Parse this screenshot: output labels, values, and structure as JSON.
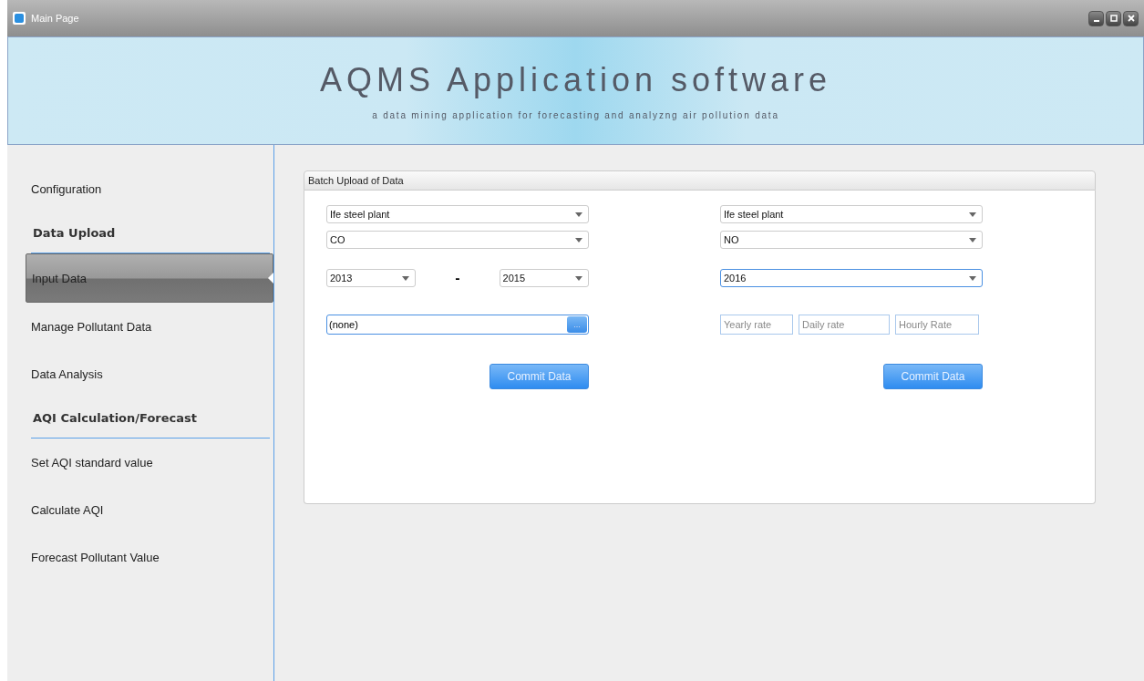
{
  "window": {
    "title": "Main Page"
  },
  "header": {
    "title": "AQMS Application software",
    "subtitle": "a data mining application for forecasting and analyzng air pollution data"
  },
  "sidebar": {
    "items": [
      {
        "kind": "item",
        "label": "Configuration",
        "selected": false
      },
      {
        "kind": "heading",
        "label": "Data Upload"
      },
      {
        "kind": "item",
        "label": "Input Data",
        "selected": true
      },
      {
        "kind": "item",
        "label": "Manage Pollutant Data",
        "selected": false
      },
      {
        "kind": "item",
        "label": "Data Analysis",
        "selected": false
      },
      {
        "kind": "heading",
        "label": "AQI Calculation/Forecast"
      },
      {
        "kind": "item",
        "label": "Set AQI standard value",
        "selected": false
      },
      {
        "kind": "item",
        "label": "Calculate AQI",
        "selected": false
      },
      {
        "kind": "item",
        "label": "Forecast Pollutant Value",
        "selected": false
      }
    ]
  },
  "panel": {
    "title": "Batch Upload of Data",
    "left": {
      "station": {
        "value": "Ife steel plant",
        "focused": false
      },
      "pollutant": {
        "value": "CO",
        "focused": false
      },
      "year_from": {
        "value": "2013",
        "focused": false
      },
      "separator": "-",
      "year_to": {
        "value": "2015",
        "focused": false
      },
      "file": {
        "value": "(none)",
        "button": "...",
        "focused": true
      },
      "commit": "Commit Data"
    },
    "right": {
      "station": {
        "value": "Ife steel plant",
        "focused": false
      },
      "pollutant": {
        "value": "NO",
        "focused": false
      },
      "year": {
        "value": "2016",
        "focused": true
      },
      "rates": [
        {
          "placeholder": "Yearly rate"
        },
        {
          "placeholder": "Daily rate"
        },
        {
          "placeholder": "Hourly Rate"
        }
      ],
      "commit": "Commit Data"
    }
  }
}
